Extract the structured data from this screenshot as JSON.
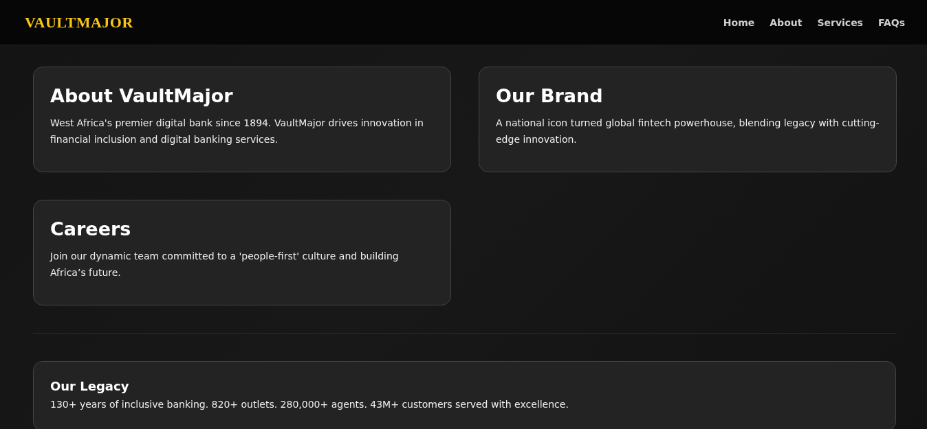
{
  "header": {
    "logo": "VAULTMAJOR",
    "nav": [
      {
        "label": "Home"
      },
      {
        "label": "About"
      },
      {
        "label": "Services"
      },
      {
        "label": "FAQs"
      }
    ]
  },
  "cards": [
    {
      "title": "About VaultMajor",
      "text": "West Africa's premier digital bank since 1894. VaultMajor drives innovation in financial inclusion and digital banking services."
    },
    {
      "title": "Our Brand",
      "text": "A national icon turned global fintech powerhouse, blending legacy with cutting-edge innovation."
    },
    {
      "title": "Careers",
      "text": "Join our dynamic team committed to a 'people-first' culture and building Africa’s future."
    }
  ],
  "legacy": {
    "title": "Our Legacy",
    "text": "130+ years of inclusive banking. 820+ outlets. 280,000+ agents. 43M+ customers served with excellence."
  }
}
